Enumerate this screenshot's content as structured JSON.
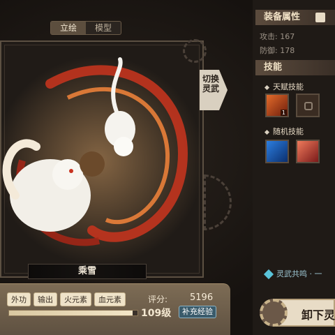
{
  "view_tabs": [
    "立绘",
    "模型"
  ],
  "switch_button": "切换\n灵武",
  "character_name": "乘雪",
  "tags": [
    "外功",
    "输出",
    "火元素",
    "血元素"
  ],
  "score": {
    "label": "评分:",
    "value": "5196"
  },
  "level": {
    "text": "109级",
    "progress_fraction": 0.96
  },
  "exp_button": "补充经验",
  "attributes": {
    "title": "装备属性",
    "stats": [
      {
        "label": "攻击:",
        "value": "167"
      },
      {
        "label": "防御:",
        "value": "178"
      }
    ]
  },
  "skills": {
    "title": "技能",
    "talent_title": "天赋技能",
    "random_title": "随机技能",
    "talent_badge": "1"
  },
  "resonance_text": "灵武共鸣 · 一",
  "unload_button": "卸下灵",
  "colors": {
    "accent": "#c23b24",
    "panel": "#7d6c55"
  }
}
